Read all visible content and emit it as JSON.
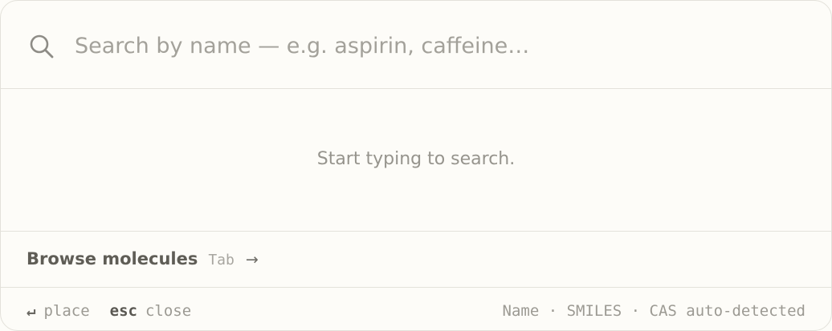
{
  "search": {
    "placeholder": "Search by name — e.g. aspirin, caffeine…",
    "value": ""
  },
  "icons": {
    "search": "search-icon",
    "enter": "enter-icon",
    "arrow": "arrow-right-icon"
  },
  "results": {
    "empty_message": "Start typing to search."
  },
  "browse": {
    "label": "Browse molecules",
    "key": "Tab",
    "arrow": "→"
  },
  "footer": {
    "hints": [
      {
        "key": "↵",
        "label": "place"
      },
      {
        "key": "esc",
        "label": "close"
      }
    ],
    "detect_note": "Name · SMILES · CAS auto-detected"
  },
  "colors": {
    "background": "#fdfcf8",
    "divider": "#e4e2db",
    "text_muted": "#9c9a93",
    "text_strong": "#5f5d56"
  }
}
